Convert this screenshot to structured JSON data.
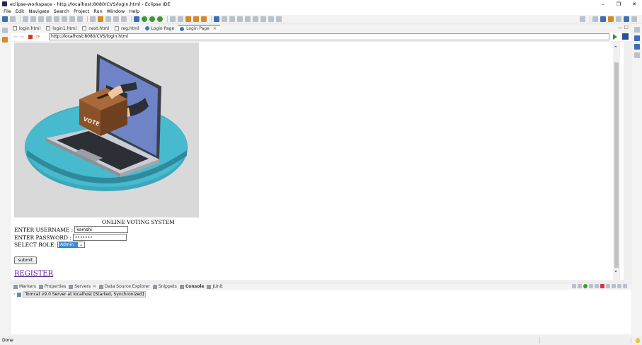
{
  "window": {
    "title": "eclipse-workspace - http://localhost:8080/CVS/login.html - Eclipse IDE",
    "minimize": "–",
    "maximize": "❐",
    "close": "✕"
  },
  "menu": [
    "File",
    "Edit",
    "Navigate",
    "Search",
    "Project",
    "Run",
    "Window",
    "Help"
  ],
  "editor_tabs": [
    {
      "label": "login.html",
      "kind": "file"
    },
    {
      "label": "login1.html",
      "kind": "file"
    },
    {
      "label": "next.html",
      "kind": "file"
    },
    {
      "label": "reg.html",
      "kind": "file"
    },
    {
      "label": "Login Page",
      "kind": "browser"
    },
    {
      "label": "Login Page",
      "kind": "browser",
      "active": true
    }
  ],
  "browser": {
    "url": "http://localhost:8080/CVS/login.html"
  },
  "page": {
    "system_title": "ONLINE VOTING SYSTEM",
    "username_label": "ENTER USERNAME :",
    "username_value": "Vamshi",
    "password_label": "ENTER PASSWORD :",
    "password_value": "•••••••",
    "role_label": "SELECT ROLE:",
    "role_value": "Admin",
    "submit_label": "submit",
    "register_label": "REGISTER",
    "illustration_text": "VOTE"
  },
  "bottom_tabs": [
    {
      "label": "Markers"
    },
    {
      "label": "Properties"
    },
    {
      "label": "Servers",
      "closable": true
    },
    {
      "label": "Data Source Explorer"
    },
    {
      "label": "Snippets"
    },
    {
      "label": "Console",
      "active": true
    },
    {
      "label": "JUnit"
    }
  ],
  "server_entry": "Tomcat v9.0 Server at localhost  [Started, Synchronized]",
  "status": "Done",
  "colors": {
    "accent": "#3b6fb6",
    "link": "#551a8b",
    "select_highlight": "#3b8fd9",
    "platform": "#3da8bd",
    "laptop_screen": "#6f84c7"
  }
}
